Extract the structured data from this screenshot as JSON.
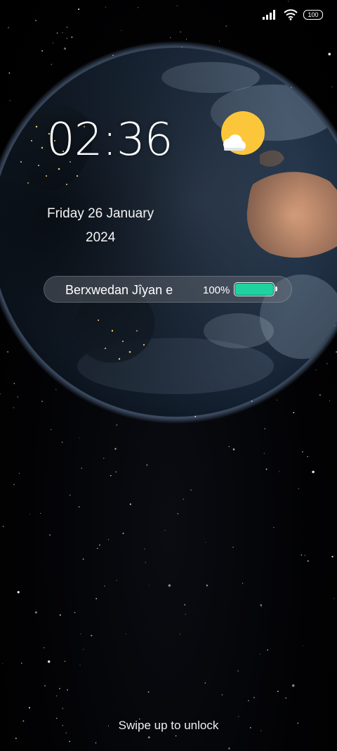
{
  "status_bar": {
    "battery_level_text": "100",
    "icons": [
      "signal-icon",
      "wifi-icon",
      "battery-icon"
    ]
  },
  "lock_screen": {
    "time": "02:36",
    "date": "Friday 26 January",
    "year": "2024",
    "weather_icon": "partly-sunny-icon",
    "battery_widget": {
      "label": "Berxwedan Jîyan e",
      "percent_text": "100%",
      "level": 1.0,
      "fill_color": "#1fd3a1"
    },
    "unlock_hint": "Swipe up to unlock"
  },
  "colors": {
    "background": "#000000",
    "sun": "#fcc63a",
    "accent": "#1fd3a1"
  }
}
